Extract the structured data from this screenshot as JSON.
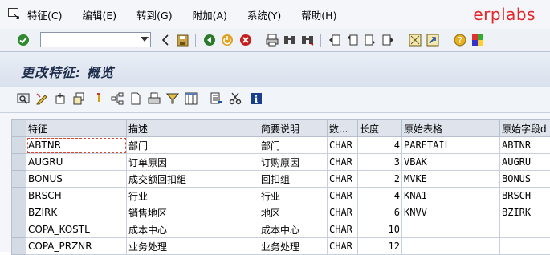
{
  "menubar": {
    "items": [
      "特征(C)",
      "编辑(E)",
      "转到(G)",
      "附加(A)",
      "系统(Y)",
      "帮助(H)"
    ],
    "brand": "erplabs"
  },
  "toolbar": {
    "command_field_value": ""
  },
  "page": {
    "title": "更改特征: 概览"
  },
  "table": {
    "headers": [
      "特征",
      "描述",
      "简要说明",
      "数...",
      "长度",
      "原始表格",
      "原始字段d"
    ],
    "rows": [
      [
        "ABTNR",
        "部门",
        "部门",
        "CHAR",
        "4",
        "PARETAIL",
        "ABTNR"
      ],
      [
        "AUGRU",
        "订单原因",
        "订购原因",
        "CHAR",
        "3",
        "VBAK",
        "AUGRU"
      ],
      [
        "BONUS",
        "成交额回扣組",
        "回扣组",
        "CHAR",
        "2",
        "MVKE",
        "BONUS"
      ],
      [
        "BRSCH",
        "行业",
        "行业",
        "CHAR",
        "4",
        "KNA1",
        "BRSCH"
      ],
      [
        "BZIRK",
        "销售地区",
        "地区",
        "CHAR",
        "6",
        "KNVV",
        "BZIRK"
      ],
      [
        "COPA_KOSTL",
        "成本中心",
        "成本中心",
        "CHAR",
        "10",
        "",
        ""
      ],
      [
        "COPA_PRZNR",
        "业务处理",
        "业务处理",
        "CHAR",
        "12",
        "",
        ""
      ]
    ]
  },
  "colors": {
    "brand": "#e4262a",
    "header_bg": "#dfe4ec",
    "title_color": "#1d2c4a"
  }
}
